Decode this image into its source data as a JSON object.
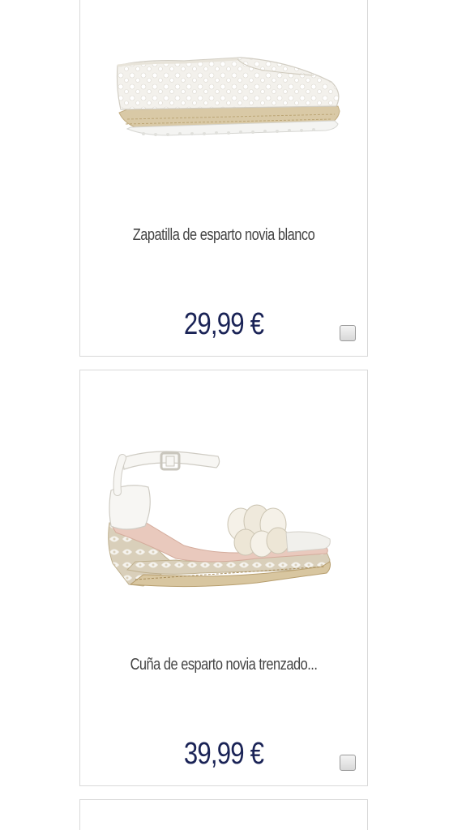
{
  "products": [
    {
      "name": "Zapatilla de esparto novia blanco",
      "price": "29,99 €",
      "image_icon": "espadrille-shoe-image"
    },
    {
      "name": "Cuña de esparto novia trenzado...",
      "price": "39,99 €",
      "image_icon": "wedge-sandal-image"
    }
  ],
  "colors": {
    "price": "#1a2356",
    "name": "#444444",
    "card_border": "#d9d9d9"
  }
}
